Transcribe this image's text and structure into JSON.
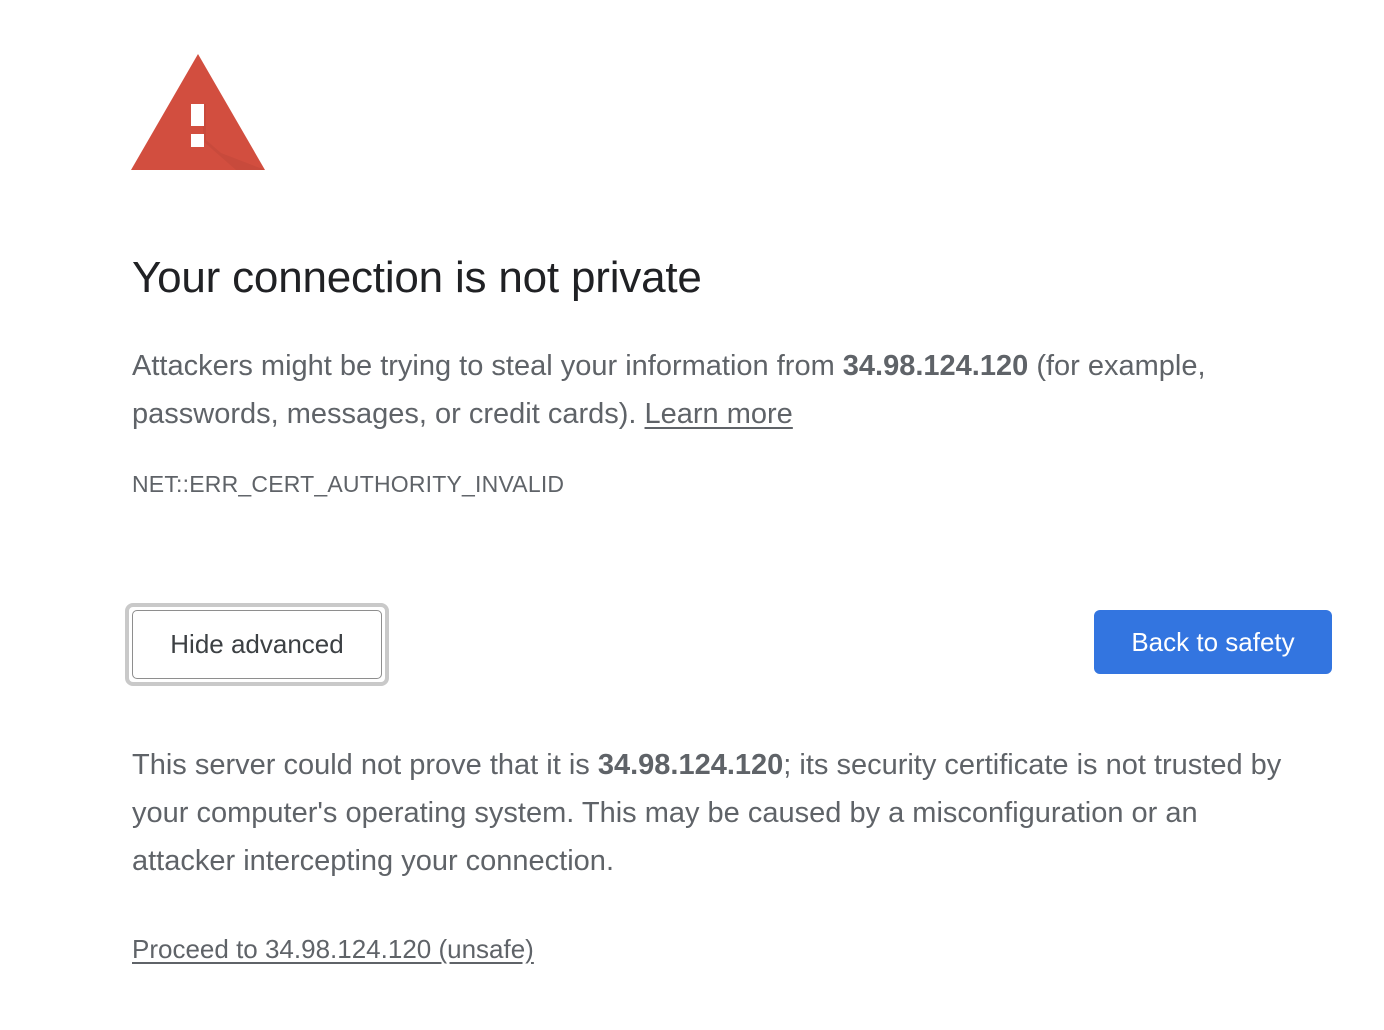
{
  "icon": {
    "name": "warning-triangle-icon",
    "color": "#d24e3f",
    "mark_color": "#ffffff"
  },
  "title": "Your connection is not private",
  "message": {
    "before": "Attackers might be trying to steal your information from ",
    "host": "34.98.124.120",
    "after": " (for example, passwords, messages, or credit cards). ",
    "learn_more": "Learn more"
  },
  "error_code": "NET::ERR_CERT_AUTHORITY_INVALID",
  "buttons": {
    "hide_advanced": "Hide advanced",
    "back_to_safety": "Back to safety"
  },
  "details": {
    "before": "This server could not prove that it is ",
    "host": "34.98.124.120",
    "after": "; its security certificate is not trusted by your computer's operating system. This may be caused by a misconfiguration or an attacker intercepting your connection."
  },
  "proceed_link": "Proceed to 34.98.124.120 (unsafe)",
  "colors": {
    "accent": "#3375e0",
    "title": "#202124",
    "text": "#5f6368",
    "background": "#ffffff"
  }
}
